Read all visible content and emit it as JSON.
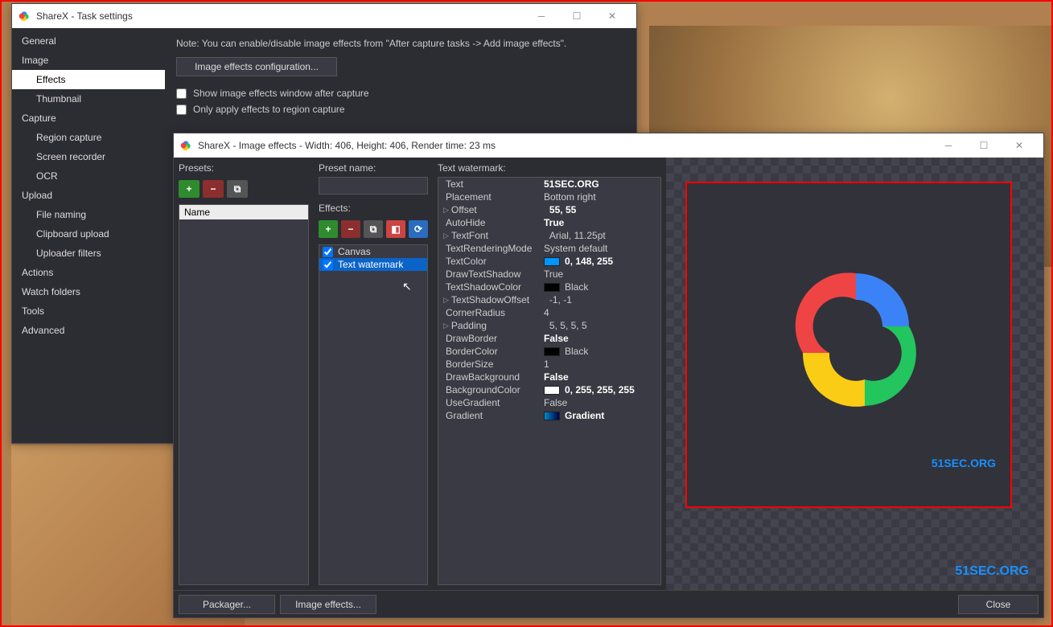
{
  "mainWin": {
    "title": "ShareX - Task settings",
    "note": "Note: You can enable/disable image effects from \"After capture tasks -> Add image effects\".",
    "configBtn": "Image effects configuration...",
    "chk1": "Show image effects window after capture",
    "chk2": "Only apply effects to region capture",
    "nav": [
      "General",
      "Image",
      "Effects",
      "Thumbnail",
      "Capture",
      "Region capture",
      "Screen recorder",
      "OCR",
      "Upload",
      "File naming",
      "Clipboard upload",
      "Uploader filters",
      "Actions",
      "Watch folders",
      "Tools",
      "Advanced"
    ],
    "navDepths": [
      0,
      0,
      1,
      1,
      0,
      1,
      1,
      1,
      0,
      1,
      1,
      1,
      0,
      0,
      0,
      0
    ],
    "navSelected": 2
  },
  "fxWin": {
    "title": "ShareX - Image effects - Width: 406, Height: 406, Render time: 23 ms",
    "presetsLabel": "Presets:",
    "presetNameLabel": "Preset name:",
    "effectsLabel": "Effects:",
    "propsLabel": "Text watermark:",
    "nameHeader": "Name",
    "effects": [
      {
        "name": "Canvas",
        "checked": true,
        "sel": false
      },
      {
        "name": "Text watermark",
        "checked": true,
        "sel": true
      }
    ],
    "props": [
      {
        "name": "Text",
        "val": "51SEC.ORG",
        "bold": true
      },
      {
        "name": "Placement",
        "val": "Bottom right"
      },
      {
        "name": "Offset",
        "val": "55, 55",
        "bold": true,
        "tri": true
      },
      {
        "name": "AutoHide",
        "val": "True",
        "bold": true
      },
      {
        "name": "TextFont",
        "val": "Arial, 11.25pt",
        "tri": true
      },
      {
        "name": "TextRenderingMode",
        "val": "System default"
      },
      {
        "name": "TextColor",
        "val": "0, 148, 255",
        "bold": true,
        "color": "#0094ff"
      },
      {
        "name": "DrawTextShadow",
        "val": "True"
      },
      {
        "name": "TextShadowColor",
        "val": "Black",
        "color": "#000"
      },
      {
        "name": "TextShadowOffset",
        "val": "-1, -1",
        "tri": true
      },
      {
        "name": "CornerRadius",
        "val": "4"
      },
      {
        "name": "Padding",
        "val": "5, 5, 5, 5",
        "tri": true
      },
      {
        "name": "DrawBorder",
        "val": "False",
        "bold": true
      },
      {
        "name": "BorderColor",
        "val": "Black",
        "color": "#000"
      },
      {
        "name": "BorderSize",
        "val": "1"
      },
      {
        "name": "DrawBackground",
        "val": "False",
        "bold": true
      },
      {
        "name": "BackgroundColor",
        "val": "0, 255, 255, 255",
        "bold": true,
        "color": "#fff"
      },
      {
        "name": "UseGradient",
        "val": "False"
      },
      {
        "name": "Gradient",
        "val": "Gradient",
        "bold": true,
        "grad": true
      }
    ],
    "watermarkInner": "51SEC.ORG",
    "watermarkOuter": "51SEC.ORG",
    "packagerBtn": "Packager...",
    "effectsBtn": "Image effects...",
    "closeBtn": "Close"
  }
}
